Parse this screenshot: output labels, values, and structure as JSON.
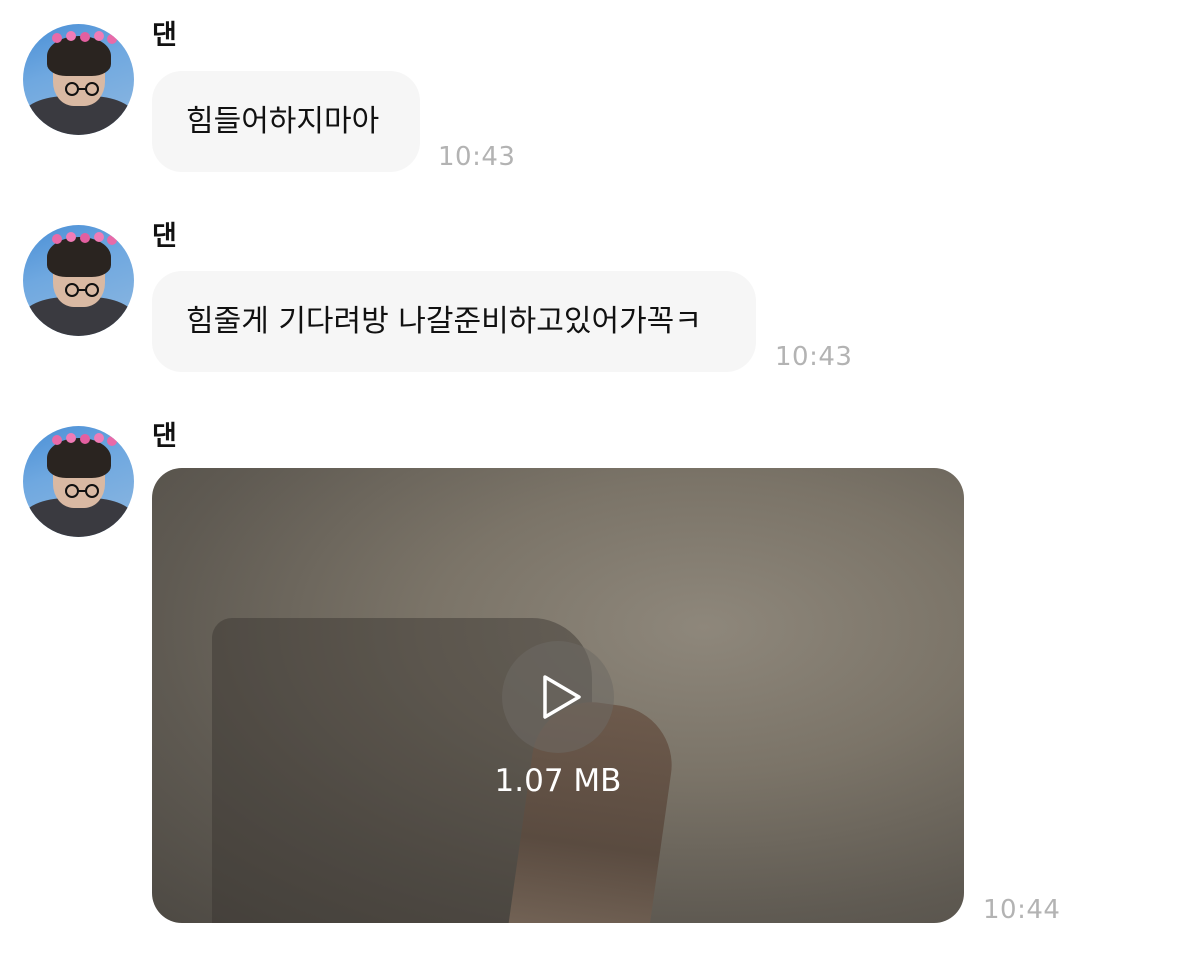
{
  "messages": [
    {
      "sender": "댄",
      "text": "힘들어하지마아",
      "time": "10:43"
    },
    {
      "sender": "댄",
      "text": "힘줄게 기다려방 나갈준비하고있어가꼭ㅋ",
      "time": "10:43"
    },
    {
      "sender": "댄",
      "video_size": "1.07 MB",
      "time": "10:44"
    }
  ],
  "icons": {
    "avatar": "profile-photo",
    "play": "play-icon"
  }
}
